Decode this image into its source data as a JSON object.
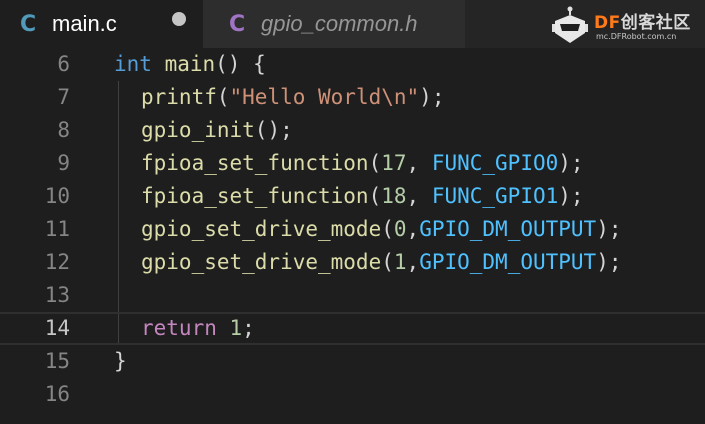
{
  "tabs": [
    {
      "icon": "C",
      "label": "main.c",
      "active": true,
      "unsaved": true
    },
    {
      "icon": "C",
      "label": "gpio_common.h",
      "active": false,
      "unsaved": false
    }
  ],
  "logo": {
    "brand_df": "DF",
    "brand_cn": "创客社区",
    "url": "mc.DFRobot.com.cn"
  },
  "editor": {
    "current_line": 14,
    "lines": [
      {
        "n": "6"
      },
      {
        "n": "7"
      },
      {
        "n": "8"
      },
      {
        "n": "9"
      },
      {
        "n": "10"
      },
      {
        "n": "11"
      },
      {
        "n": "12"
      },
      {
        "n": "13"
      },
      {
        "n": "14"
      },
      {
        "n": "15"
      },
      {
        "n": "16"
      }
    ],
    "tokens": {
      "l6": [
        "int",
        " main",
        "() {"
      ],
      "l7": [
        "printf",
        "(",
        "\"Hello World\\n\"",
        ");"
      ],
      "l8": [
        "gpio_init",
        "();"
      ],
      "l9": [
        "fpioa_set_function",
        "(",
        "17",
        ", ",
        "FUNC_GPIO0",
        ");"
      ],
      "l10": [
        "fpioa_set_function",
        "(",
        "18",
        ", ",
        "FUNC_GPIO1",
        ");"
      ],
      "l11": [
        "gpio_set_drive_mode",
        "(",
        "0",
        ",",
        "GPIO_DM_OUTPUT",
        ");"
      ],
      "l12": [
        "gpio_set_drive_mode",
        "(",
        "1",
        ",",
        "GPIO_DM_OUTPUT",
        ");"
      ],
      "l14": [
        "return",
        " ",
        "1",
        ";"
      ],
      "l15": [
        "}"
      ]
    }
  },
  "colors": {
    "background": "#1e1e1e",
    "keyword": "#569cd6",
    "function": "#dcdcaa",
    "string": "#ce9178",
    "number": "#b5cea8",
    "macro": "#4fc1ff",
    "control": "#c586c0"
  }
}
